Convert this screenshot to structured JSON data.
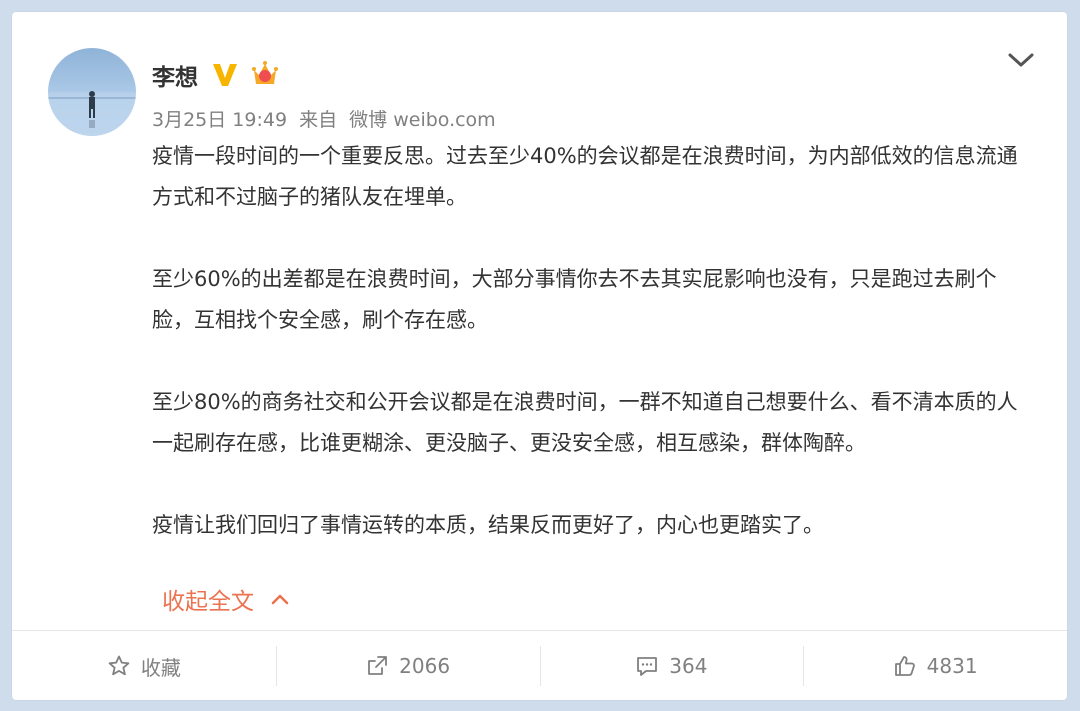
{
  "user": {
    "name": "李想"
  },
  "meta": {
    "date": "3月25日 19:49",
    "from": "来自",
    "source": "微博 weibo.com"
  },
  "post": {
    "paragraphs": [
      "疫情一段时间的一个重要反思。过去至少40%的会议都是在浪费时间，为内部低效的信息流通方式和不过脑子的猪队友在埋单。",
      "至少60%的出差都是在浪费时间，大部分事情你去不去其实屁影响也没有，只是跑过去刷个脸，互相找个安全感，刷个存在感。",
      "至少80%的商务社交和公开会议都是在浪费时间，一群不知道自己想要什么、看不清本质的人一起刷存在感，比谁更糊涂、更没脑子、更没安全感，相互感染，群体陶醉。",
      "疫情让我们回归了事情运转的本质，结果反而更好了，内心也更踏实了。"
    ],
    "collapse_label": "收起全文"
  },
  "actions": {
    "favorite_label": "收藏",
    "repost_count": "2066",
    "comment_count": "364",
    "like_count": "4831"
  },
  "colors": {
    "accent": "#eb7350",
    "text": "#333333",
    "muted": "#808080",
    "background": "#cfdcec"
  },
  "icons": [
    "avatar",
    "verified-badge-icon",
    "crown-badge-icon",
    "chevron-down-icon",
    "chevron-up-icon",
    "star-icon",
    "repost-icon",
    "comment-icon",
    "like-icon"
  ]
}
